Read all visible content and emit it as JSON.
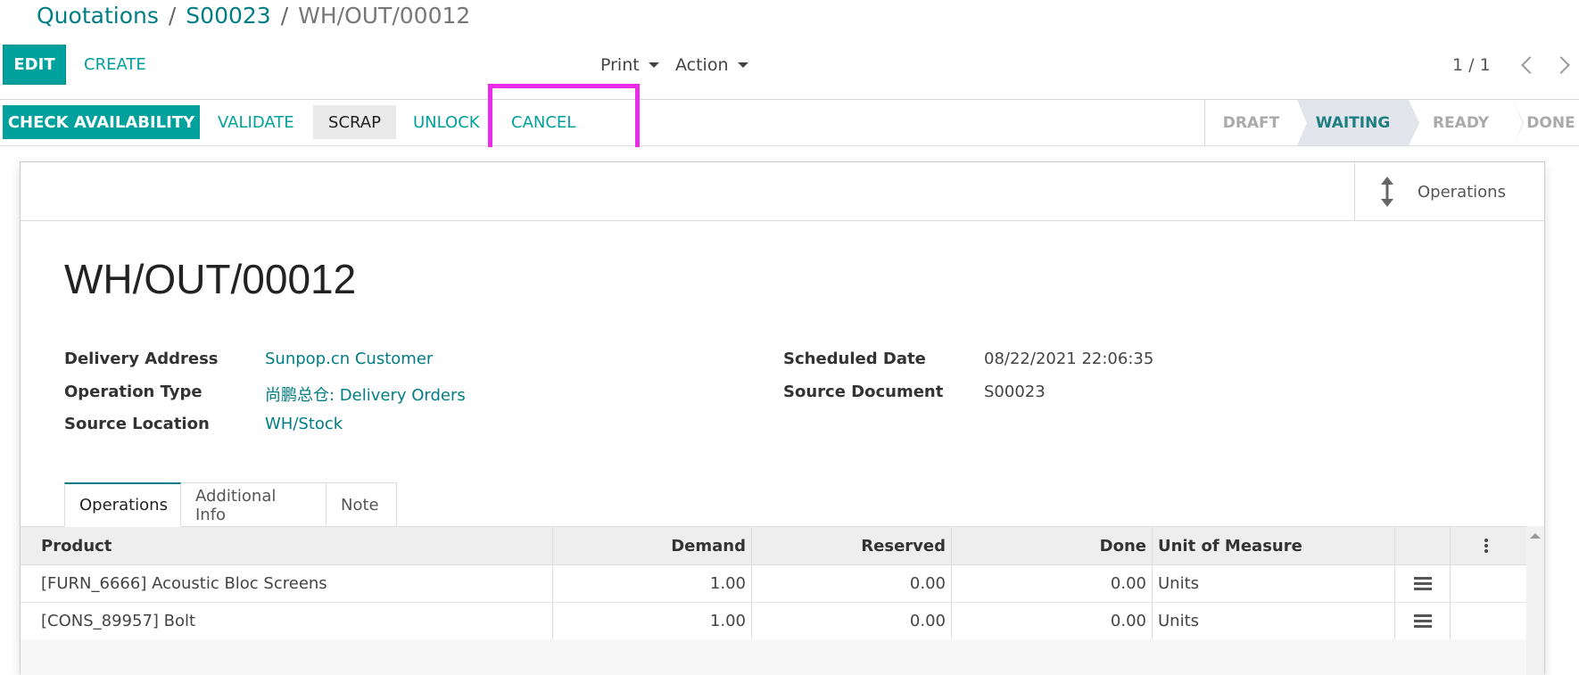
{
  "breadcrumb": {
    "items": [
      "Quotations",
      "S00023"
    ],
    "separator": "/",
    "current": "WH/OUT/00012"
  },
  "control": {
    "edit_label": "EDIT",
    "create_label": "CREATE",
    "print_label": "Print",
    "action_label": "Action",
    "pager": "1 / 1"
  },
  "statusbar": {
    "buttons": {
      "check": "CHECK AVAILABILITY",
      "validate": "VALIDATE",
      "scrap": "SCRAP",
      "unlock": "UNLOCK",
      "cancel": "CANCEL"
    },
    "stages": [
      "DRAFT",
      "WAITING",
      "READY",
      "DONE"
    ],
    "active_stage": "WAITING"
  },
  "smart_button": {
    "label": "Operations",
    "icon": "arrows-v-icon"
  },
  "record": {
    "name": "WH/OUT/00012",
    "delivery_address_label": "Delivery Address",
    "delivery_address": "Sunpop.cn Customer",
    "operation_type_label": "Operation Type",
    "operation_type": "尚鹏总仓: Delivery Orders",
    "source_location_label": "Source Location",
    "source_location": "WH/Stock",
    "scheduled_date_label": "Scheduled Date",
    "scheduled_date": "08/22/2021 22:06:35",
    "source_document_label": "Source Document",
    "source_document": "S00023"
  },
  "tabs": [
    "Operations",
    "Additional Info",
    "Note"
  ],
  "table": {
    "columns": [
      "Product",
      "Demand",
      "Reserved",
      "Done",
      "Unit of Measure"
    ],
    "rows": [
      {
        "product": "[FURN_6666] Acoustic Bloc Screens",
        "demand": "1.00",
        "reserved": "0.00",
        "done": "0.00",
        "uom": "Units"
      },
      {
        "product": "[CONS_89957] Bolt",
        "demand": "1.00",
        "reserved": "0.00",
        "done": "0.00",
        "uom": "Units"
      }
    ]
  },
  "colors": {
    "primary": "#00a09d",
    "link": "#017e84",
    "highlight": "#ea2bea"
  }
}
